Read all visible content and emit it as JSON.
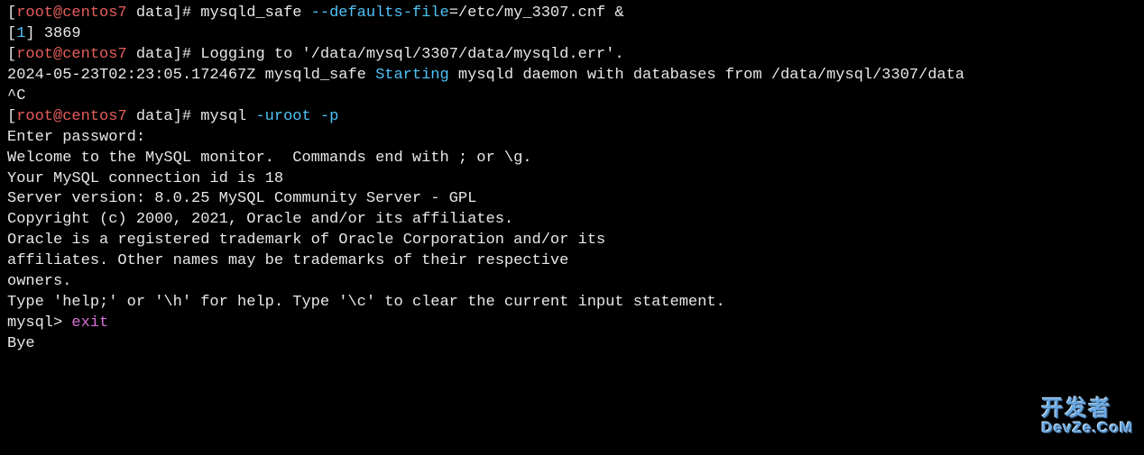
{
  "prompt1": {
    "open": "[",
    "user": "root@centos7",
    "path": " data",
    "close": "]# ",
    "cmd": "mysqld_safe ",
    "opt": "--defaults-file",
    "rest": "=/etc/my_3307.cnf &"
  },
  "job": {
    "open": "[",
    "num": "1",
    "close": "]",
    "pid": " 3869"
  },
  "prompt2": {
    "open": "[",
    "user": "root@centos7",
    "path": " data",
    "close": "]# ",
    "rest": "Logging to '/data/mysql/3307/data/mysqld.err'."
  },
  "logline": {
    "ts": "2024-05-23T02:23:05.172467Z mysqld_safe ",
    "starting": "Starting",
    "rest": " mysqld daemon with databases from /data/mysql/3307/data"
  },
  "ctrlc": "^C",
  "prompt3": {
    "open": "[",
    "user": "root@centos7",
    "path": " data",
    "close": "]# ",
    "cmd": "mysql ",
    "opt1": "-uroot",
    "sp": " ",
    "opt2": "-p"
  },
  "banner": {
    "enter_pw": "Enter password:",
    "welcome": "Welcome to the MySQL monitor.  Commands end with ; or \\g.",
    "conn_id": "Your MySQL connection id is 18",
    "version": "Server version: 8.0.25 MySQL Community Server - GPL",
    "blank1": "",
    "copyright": "Copyright (c) 2000, 2021, Oracle and/or its affiliates.",
    "blank2": "",
    "tm1": "Oracle is a registered trademark of Oracle Corporation and/or its",
    "tm2": "affiliates. Other names may be trademarks of their respective",
    "tm3": "owners.",
    "blank3": "",
    "help": "Type 'help;' or '\\h' for help. Type '\\c' to clear the current input statement.",
    "blank4": ""
  },
  "mysql_prompt": {
    "prompt": "mysql> ",
    "cmd": "exit"
  },
  "bye": "Bye",
  "watermark": {
    "top": "开发者",
    "bottom": "DevZe.CoM"
  }
}
